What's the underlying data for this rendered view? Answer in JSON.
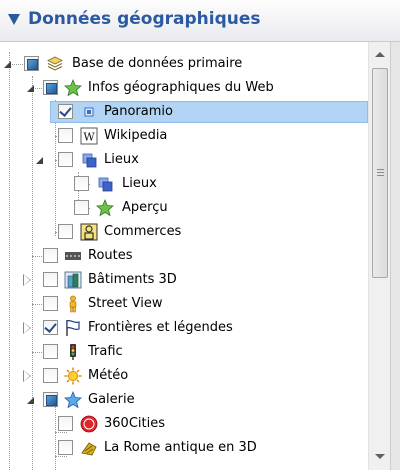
{
  "panel": {
    "title": "Données géographiques"
  },
  "tree": {
    "items": [
      {
        "label": "Base de données primaire",
        "icon": "layers-icon",
        "checkbox": "partial",
        "expanded": true
      },
      {
        "label": "Infos géographiques du Web",
        "icon": "green-star-icon",
        "checkbox": "partial",
        "expanded": true
      },
      {
        "label": "Panoramio",
        "icon": "panoramio-icon",
        "checkbox": "checked",
        "selected": true
      },
      {
        "label": "Wikipedia",
        "icon": "wikipedia-icon",
        "checkbox": "unchecked"
      },
      {
        "label": "Lieux",
        "icon": "places-icon",
        "checkbox": "unchecked",
        "expanded": true
      },
      {
        "label": "Lieux",
        "icon": "places-icon",
        "checkbox": "unchecked"
      },
      {
        "label": "Aperçu",
        "icon": "green-star-icon",
        "checkbox": "unchecked"
      },
      {
        "label": "Commerces",
        "icon": "shops-icon",
        "checkbox": "unchecked"
      },
      {
        "label": "Routes",
        "icon": "roads-icon",
        "checkbox": "unchecked"
      },
      {
        "label": "Bâtiments 3D",
        "icon": "buildings-3d-icon",
        "checkbox": "unchecked",
        "expanded": false
      },
      {
        "label": "Street View",
        "icon": "pegman-icon",
        "checkbox": "unchecked"
      },
      {
        "label": "Frontières et légendes",
        "icon": "flag-icon",
        "checkbox": "checked",
        "expanded": false
      },
      {
        "label": "Trafic",
        "icon": "traffic-light-icon",
        "checkbox": "unchecked"
      },
      {
        "label": "Météo",
        "icon": "sun-icon",
        "checkbox": "unchecked",
        "expanded": false
      },
      {
        "label": "Galerie",
        "icon": "blue-star-icon",
        "checkbox": "partial",
        "expanded": true
      },
      {
        "label": "360Cities",
        "icon": "360cities-icon",
        "checkbox": "unchecked"
      },
      {
        "label": "La Rome antique en 3D",
        "icon": "ancient-rome-icon",
        "checkbox": "unchecked"
      }
    ]
  }
}
